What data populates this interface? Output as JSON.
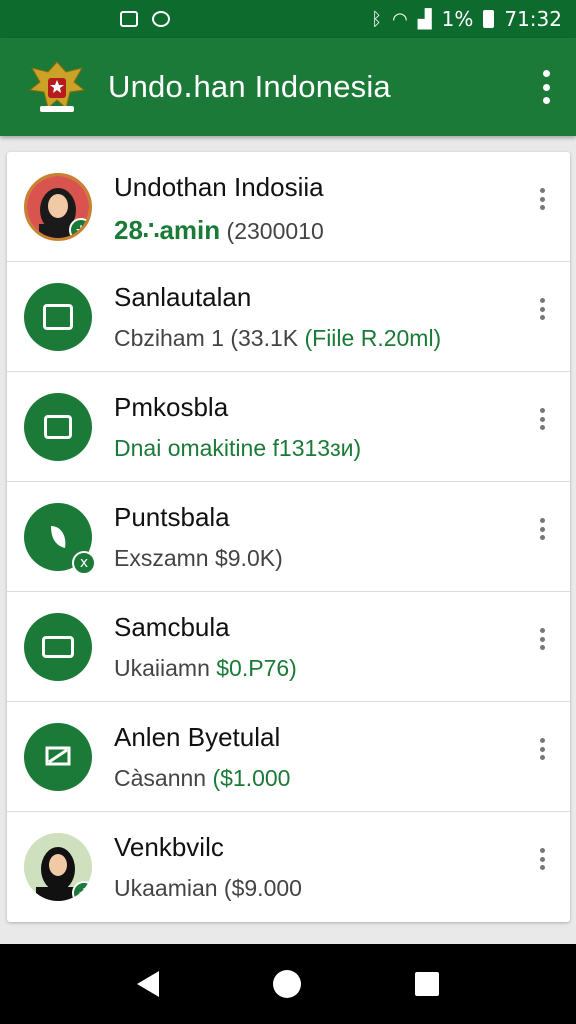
{
  "status_bar": {
    "battery": "1%",
    "time": "71:32",
    "icons": [
      "image-icon",
      "messenger-icon",
      "bluetooth-icon",
      "wifi-icon",
      "signal-icon",
      "battery-icon"
    ]
  },
  "app_bar": {
    "title": "Undo․han Indonesia",
    "logo": "garuda-emblem"
  },
  "list": {
    "items": [
      {
        "title": "Undothan Indosiia",
        "subtitle_accent": "28∴amin",
        "subtitle": " (2300010",
        "avatar": "person-photo",
        "badge": "+"
      },
      {
        "title": "Sanlautalan",
        "subtitle": "Cbziham 1 (33.1K ",
        "subtitle_accent": "(Fiile R.20ml)",
        "avatar": "document-icon"
      },
      {
        "title": "Pmkosbla",
        "subtitle_accent": "Dnai omakitine f1313ɜи)",
        "avatar": "image-icon"
      },
      {
        "title": "Puntsbala",
        "subtitle": "Exszamn $9.0K)",
        "avatar": "leaf-icon",
        "badge": "x"
      },
      {
        "title": "Samcbula",
        "subtitle": "Ukaiiamn ",
        "subtitle_accent": "$0.P76)",
        "avatar": "wallet-icon"
      },
      {
        "title": "Anlen Byetulal",
        "subtitle": "Càsannn ",
        "subtitle_accent": "($1.000",
        "avatar": "flag-icon"
      },
      {
        "title": "Venkbvilc",
        "subtitle": "Ukaamian ($9.000",
        "avatar": "person-photo-2",
        "badge": "+"
      }
    ]
  },
  "colors": {
    "primary": "#1b7a37",
    "status_bar": "#0e6b2e",
    "accent_text": "#1b7a37"
  }
}
